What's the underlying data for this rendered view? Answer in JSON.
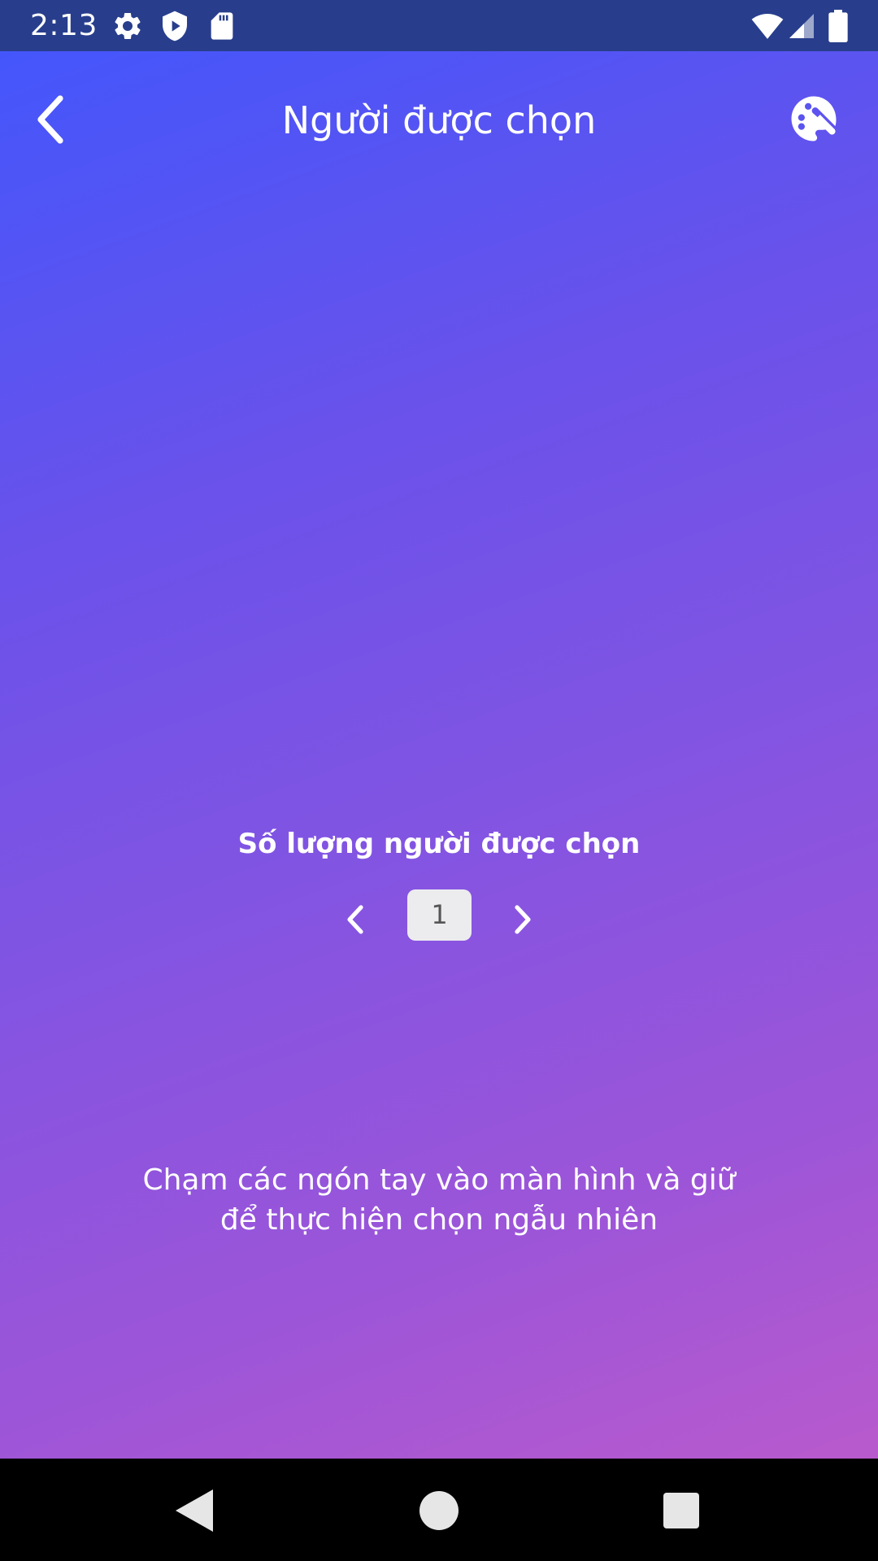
{
  "status_bar": {
    "time": "2:13",
    "left_icons": [
      "settings-icon",
      "shield-icon",
      "sd-card-icon"
    ],
    "right_icons": [
      "wifi-icon",
      "signal-icon",
      "battery-icon"
    ]
  },
  "header": {
    "title": "Người được chọn",
    "back_icon": "chevron-left-icon",
    "theme_icon": "palette-icon"
  },
  "main": {
    "count_label": "Số lượng người được chọn",
    "count_value": "1",
    "instruction_line1": "Chạm các ngón tay vào màn hình và giữ",
    "instruction_line2": "để thực hiện chọn ngẫu nhiên"
  },
  "nav_bar": {
    "buttons": [
      "back-triangle-icon",
      "home-circle-icon",
      "recents-square-icon"
    ]
  },
  "colors": {
    "status_bar": "#283e8c",
    "gradient_start": "#4456fb",
    "gradient_end": "#b85acd",
    "stepper_bg": "#ececef"
  }
}
